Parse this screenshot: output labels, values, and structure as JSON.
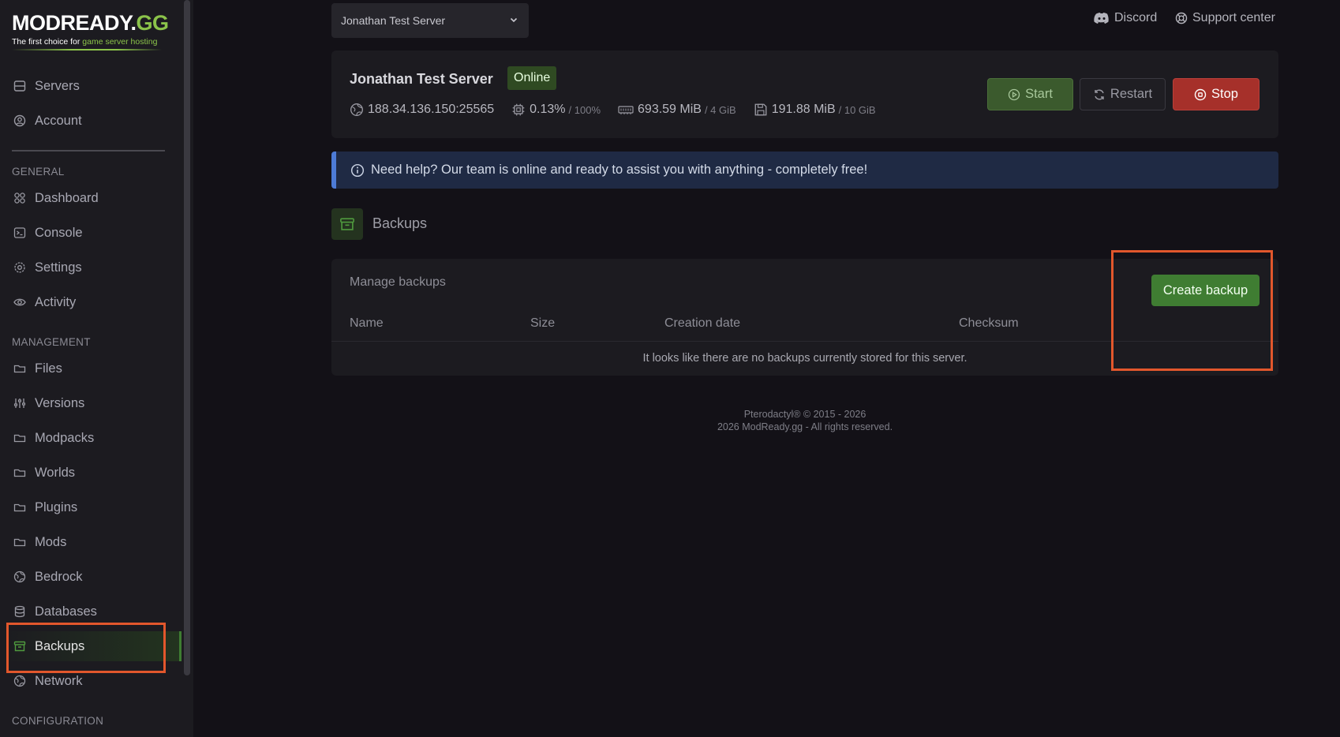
{
  "brand": {
    "logo_main": "MODREADY.",
    "logo_gg": "GG",
    "tagline_prefix": "The first choice for ",
    "tagline_highlight": "game server hosting"
  },
  "sidebar": {
    "top_items": [
      {
        "label": "Servers",
        "icon": "server-icon"
      },
      {
        "label": "Account",
        "icon": "user-circle-icon"
      }
    ],
    "general_heading": "GENERAL",
    "general_items": [
      {
        "label": "Dashboard",
        "icon": "grid-icon"
      },
      {
        "label": "Console",
        "icon": "terminal-icon"
      },
      {
        "label": "Settings",
        "icon": "gear-icon"
      },
      {
        "label": "Activity",
        "icon": "eye-icon"
      }
    ],
    "management_heading": "MANAGEMENT",
    "management_items": [
      {
        "label": "Files",
        "icon": "folder-icon"
      },
      {
        "label": "Versions",
        "icon": "sliders-icon"
      },
      {
        "label": "Modpacks",
        "icon": "folder-icon"
      },
      {
        "label": "Worlds",
        "icon": "folder-icon"
      },
      {
        "label": "Plugins",
        "icon": "folder-icon"
      },
      {
        "label": "Mods",
        "icon": "folder-icon"
      },
      {
        "label": "Bedrock",
        "icon": "globe-icon"
      },
      {
        "label": "Databases",
        "icon": "database-icon"
      },
      {
        "label": "Backups",
        "icon": "archive-icon",
        "active": true
      },
      {
        "label": "Network",
        "icon": "globe-icon"
      }
    ],
    "configuration_heading": "CONFIGURATION"
  },
  "topbar": {
    "server_select_value": "Jonathan Test Server",
    "discord_label": "Discord",
    "support_label": "Support center"
  },
  "server": {
    "name": "Jonathan Test Server",
    "status": "Online",
    "address": "188.34.136.150:25565",
    "cpu": "0.13%",
    "cpu_limit": "/ 100%",
    "memory": "693.59 MiB",
    "memory_limit": "/ 4 GiB",
    "disk": "191.88 MiB",
    "disk_limit": "/ 10 GiB",
    "start_label": "Start",
    "restart_label": "Restart",
    "stop_label": "Stop"
  },
  "alert": {
    "text": "Need help? Our team is online and ready to assist you with anything - completely free!"
  },
  "section": {
    "title": "Backups"
  },
  "backups": {
    "manage_title": "Manage backups",
    "create_label": "Create backup",
    "columns": [
      "Name",
      "Size",
      "Creation date",
      "Checksum"
    ],
    "empty_message": "It looks like there are no backups currently stored for this server."
  },
  "footer": {
    "line1": "Pterodactyl® © 2015 - 2026",
    "line2": "2026 ModReady.gg - All rights reserved."
  },
  "colors": {
    "accent_green": "#3f7d32",
    "stop_red": "#a6302a",
    "highlight_orange": "#e2572c",
    "alert_blue": "#4d7bd6"
  }
}
